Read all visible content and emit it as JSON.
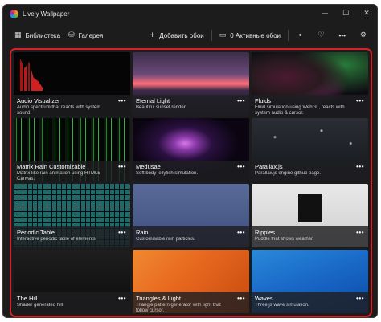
{
  "window": {
    "title": "Lively Wallpaper",
    "controls": {
      "minimize": "—",
      "maximize": "☐",
      "close": "✕"
    }
  },
  "toolbar": {
    "library_label": "Библиотека",
    "gallery_label": "Галерея",
    "add_label": "Добавить обои",
    "active_label": "0 Активные обои",
    "more_label": "•••"
  },
  "cards": [
    {
      "title": "Audio Visualizer",
      "desc": "Audio spectrum that reacts with system sound",
      "thumb": "t-audio"
    },
    {
      "title": "Eternal Light",
      "desc": "Beautiful sunset render.",
      "thumb": "t-eternal"
    },
    {
      "title": "Fluids",
      "desc": "Fluid simulation using WebGL, reacts with system audio & cursor.",
      "thumb": "t-fluids"
    },
    {
      "title": "Matrix Rain Customizable",
      "desc": "Matrix like rain animation using HTML5 Canvas.",
      "thumb": "t-matrix"
    },
    {
      "title": "Medusae",
      "desc": "Soft body jellyfish simulation.",
      "thumb": "t-meduse"
    },
    {
      "title": "Parallax.js",
      "desc": "Parallax.js engine github page.",
      "thumb": "t-parallax"
    },
    {
      "title": "Periodic Table",
      "desc": "Interactive periodic table of elements.",
      "thumb": "t-periodic"
    },
    {
      "title": "Rain",
      "desc": "Customisable rain particles.",
      "thumb": "t-rain"
    },
    {
      "title": "Ripples",
      "desc": "Puddle that shows weather.",
      "thumb": "t-ripples"
    },
    {
      "title": "The Hill",
      "desc": "Shader generated hill.",
      "thumb": "t-hill"
    },
    {
      "title": "Triangles & Light",
      "desc": "Triangle pattern generator with light that follow cursor.",
      "thumb": "t-triangles"
    },
    {
      "title": "Waves",
      "desc": "Three.js wave simulation.",
      "thumb": "t-waves"
    }
  ],
  "card_more_label": "•••",
  "colors": {
    "highlight_border": "#d8202a",
    "background": "#1c1c1c"
  }
}
